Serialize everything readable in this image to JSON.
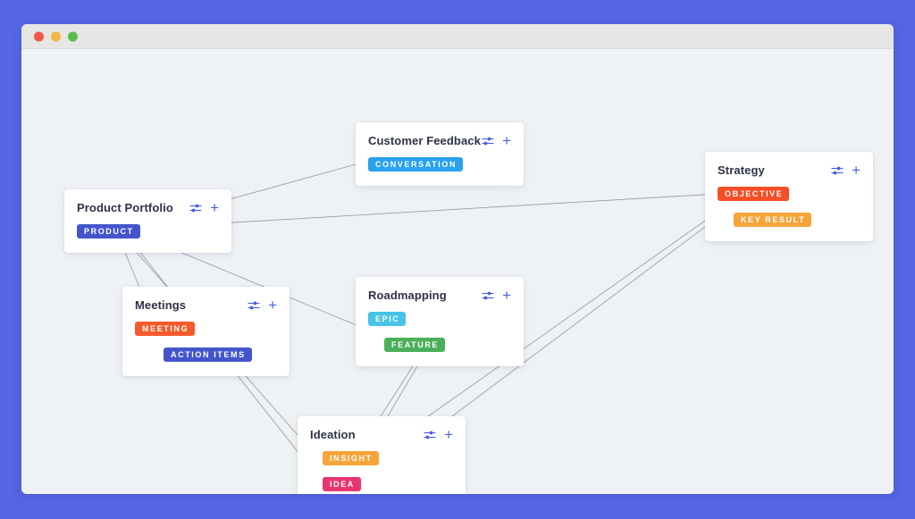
{
  "window": {
    "traffic_lights": [
      {
        "name": "close",
        "color": "#F2584A"
      },
      {
        "name": "minimize",
        "color": "#F4B63F"
      },
      {
        "name": "maximize",
        "color": "#5DBB4B"
      }
    ],
    "background_color": "#5667E6",
    "canvas_color": "#EFF2F5",
    "titlebar_color": "#E6E6E4"
  },
  "icons": {
    "settings": "sliders-icon",
    "add": "plus-icon",
    "add_label": "+"
  },
  "cards": [
    {
      "id": "product-portfolio",
      "title": "Product Portfolio",
      "tags": [
        {
          "label": "PRODUCT",
          "color": "#4455CC",
          "indent": 0
        }
      ]
    },
    {
      "id": "customer-feedback",
      "title": "Customer Feedback",
      "tags": [
        {
          "label": "CONVERSATION",
          "color": "#28A1F0",
          "indent": 0
        }
      ]
    },
    {
      "id": "strategy",
      "title": "Strategy",
      "tags": [
        {
          "label": "OBJECTIVE",
          "color": "#F74E25",
          "indent": 0
        },
        {
          "label": "KEY RESULT",
          "color": "#F7A43A",
          "indent": 1
        }
      ]
    },
    {
      "id": "meetings",
      "title": "Meetings",
      "tags": [
        {
          "label": "MEETING",
          "color": "#F55A2C",
          "indent": 0
        },
        {
          "label": "ACTION ITEMS",
          "color": "#4455CC",
          "indent": 2
        }
      ]
    },
    {
      "id": "roadmapping",
      "title": "Roadmapping",
      "tags": [
        {
          "label": "EPIC",
          "color": "#47C3E8",
          "indent": 0
        },
        {
          "label": "FEATURE",
          "color": "#4CAF5B",
          "indent": 1
        }
      ]
    },
    {
      "id": "ideation",
      "title": "Ideation",
      "tags": [
        {
          "label": "INSIGHT",
          "color": "#F7A43A",
          "indent": 3
        },
        {
          "label": "IDEA",
          "color": "#E8356D",
          "indent": 3
        }
      ]
    }
  ],
  "connections": [
    {
      "from": "PRODUCT",
      "to": "CONVERSATION"
    },
    {
      "from": "PRODUCT",
      "to": "OBJECTIVE"
    },
    {
      "from": "PRODUCT",
      "to": "MEETING"
    },
    {
      "from": "PRODUCT",
      "to": "INSIGHT"
    },
    {
      "from": "PRODUCT",
      "to": "IDEA"
    },
    {
      "from": "PRODUCT",
      "to": "FEATURE"
    },
    {
      "from": "OBJECTIVE",
      "to": "KEY RESULT"
    },
    {
      "from": "MEETING",
      "to": "ACTION ITEMS"
    },
    {
      "from": "EPIC",
      "to": "FEATURE"
    },
    {
      "from": "INSIGHT",
      "to": "IDEA"
    },
    {
      "from": "INSIGHT",
      "to": "FEATURE"
    },
    {
      "from": "IDEA",
      "to": "FEATURE"
    },
    {
      "from": "INSIGHT",
      "to": "OBJECTIVE"
    },
    {
      "from": "IDEA",
      "to": "OBJECTIVE"
    }
  ],
  "edge_color": "#9AA0A6"
}
